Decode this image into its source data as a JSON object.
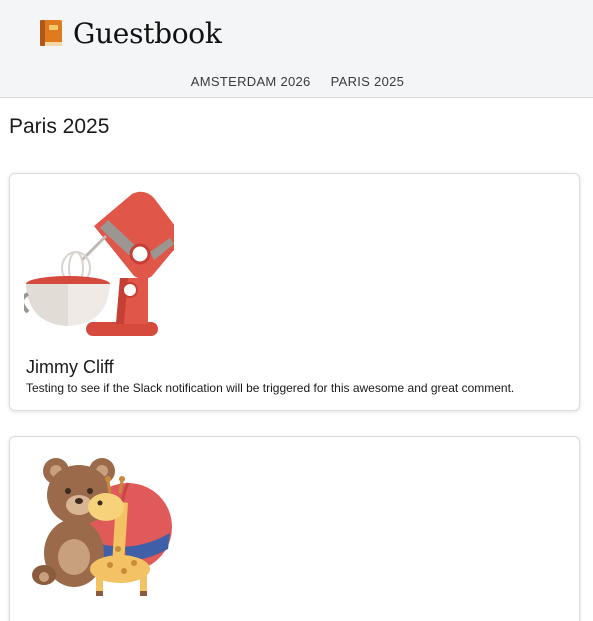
{
  "header": {
    "title": "Guestbook",
    "logo_icon": "book-icon",
    "nav": [
      {
        "label": "AMSTERDAM 2026"
      },
      {
        "label": "PARIS 2025"
      }
    ]
  },
  "main": {
    "page_title": "Paris 2025",
    "entries": [
      {
        "image": "stand-mixer-illustration",
        "name": "Jimmy Cliff",
        "comment": "Testing to see if the Slack notification will be triggered for this awesome and great comment."
      },
      {
        "image": "teddy-bear-giraffe-ball-illustration",
        "name": "",
        "comment": ""
      }
    ]
  },
  "colors": {
    "header_bg": "#f4f5f7",
    "mixer_red": "#e0574a",
    "bear_brown": "#9a6a4a",
    "giraffe_yellow": "#f2c265"
  }
}
